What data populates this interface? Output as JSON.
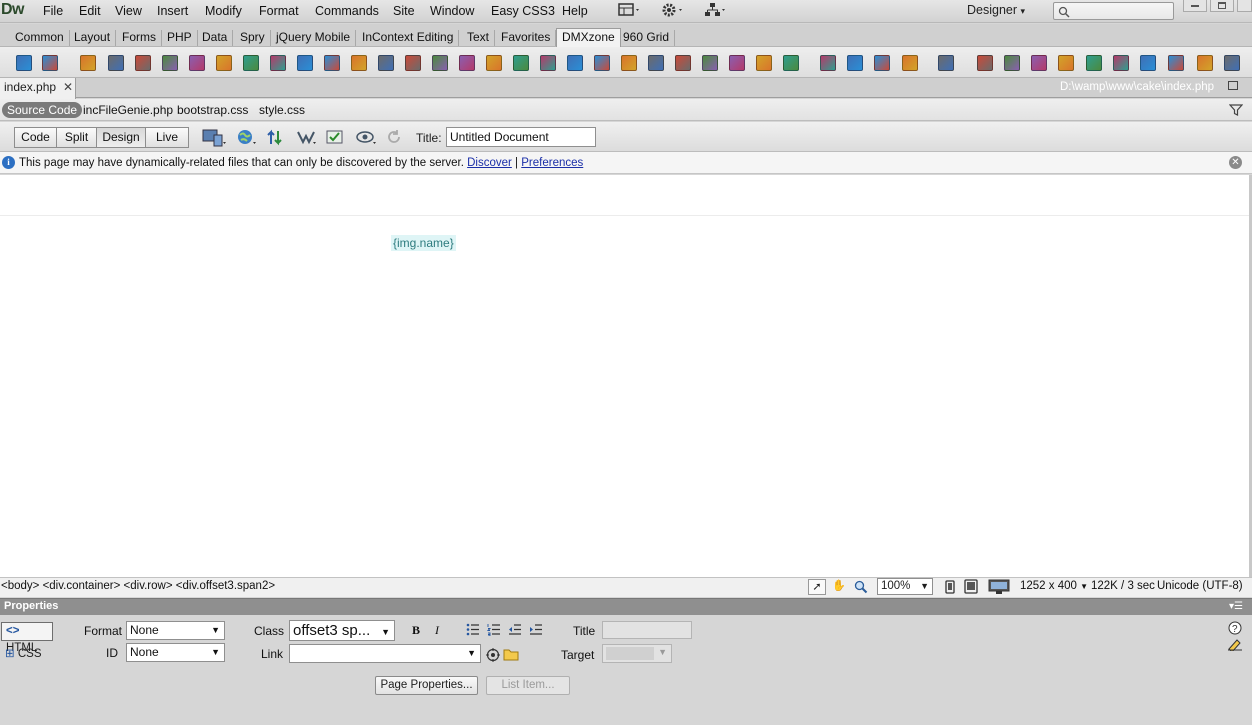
{
  "app": {
    "logo": "Dw"
  },
  "menubar": {
    "items": [
      "File",
      "Edit",
      "View",
      "Insert",
      "Modify",
      "Format",
      "Commands",
      "Site",
      "Window",
      "Easy CSS3",
      "Help"
    ],
    "workspace": "Designer"
  },
  "insert_tabs": [
    "Common",
    "Layout",
    "Forms",
    "PHP",
    "Data",
    "Spry",
    "jQuery Mobile",
    "InContext Editing",
    "Text",
    "Favorites",
    "DMXzone",
    "960 Grid"
  ],
  "insert_active": "DMXzone",
  "document": {
    "tab_label": "index.php",
    "path": "D:\\wamp\\www\\cake\\index.php",
    "related_files": [
      "Source Code",
      "incFileGenie.php",
      "bootstrap.css",
      "style.css"
    ],
    "view_buttons": [
      "Code",
      "Split",
      "Design",
      "Live"
    ],
    "active_view": "Design",
    "title_label": "Title:",
    "title_value": "Untitled Document"
  },
  "infobar": {
    "message": "This page may have dynamically-related files that can only be discovered by the server.",
    "discover_link": "Discover",
    "separator": "|",
    "preferences_link": "Preferences"
  },
  "design": {
    "placeholder": "{img.name}"
  },
  "statusbar": {
    "tag_selector": "<body> <div.container> <div.row> <div.offset3.span2>",
    "zoom": "100%",
    "window_size": "1252 x 400",
    "download": "122K / 3 sec",
    "encoding": "Unicode (UTF-8)"
  },
  "properties": {
    "header": "Properties",
    "html_btn": "HTML",
    "css_btn": "CSS",
    "format_label": "Format",
    "format_value": "None",
    "id_label": "ID",
    "id_value": "None",
    "class_label": "Class",
    "class_value": "offset3 sp...",
    "link_label": "Link",
    "link_value": "",
    "title_label": "Title",
    "target_label": "Target",
    "bold": "B",
    "italic": "I",
    "page_properties_btn": "Page Properties...",
    "list_item_btn": "List Item..."
  },
  "colors": {
    "accent_blue": "#2c6fc2",
    "placeholder_bg": "#dff5f6",
    "placeholder_text": "#2d7b7e"
  }
}
